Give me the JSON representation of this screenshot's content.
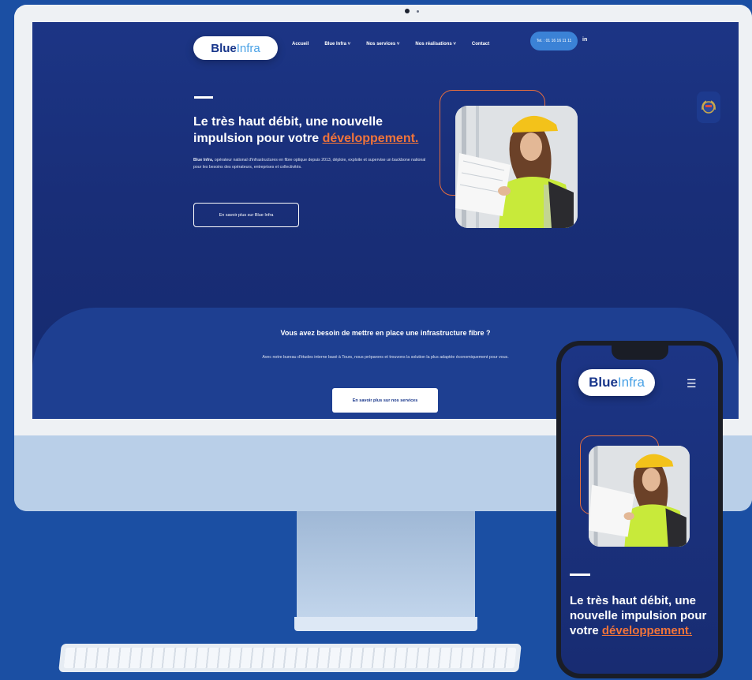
{
  "brand": {
    "name_bold": "Blue",
    "name_light": "Infra"
  },
  "nav": {
    "items": [
      "Accueil",
      "Blue Infra ˅",
      "Nos services ˅",
      "Nos réalisations ˅",
      "Contact"
    ],
    "tel": "Tel. : 01 16 16 11 11",
    "linkedin": "in"
  },
  "hero": {
    "title_plain": "Le très haut débit, une nouvelle impulsion pour votre ",
    "title_accent": "développement.",
    "desc_bold": "Blue Infra,",
    "desc_rest": " opérateur national d'infrastructures en fibre optique depuis 2013, déploie, exploite et supervise un backbone national pour les besoins des opérateurs, entreprises et collectivités.",
    "button": "En savoir plus sur Blue Infra"
  },
  "section2": {
    "title": "Vous avez besoin de mettre en place une infrastructure fibre ?",
    "desc": "Avec notre bureau d'études interne basé à Tours, nous préparons et trouvons la solution la plus adaptée économiquement pour vous.",
    "button": "En savoir plus sur nos services"
  },
  "mobile": {
    "title_plain": "Le très haut débit, une nouvelle impulsion pour votre ",
    "title_accent": "développement.",
    "menu_icon": "hamburger-icon"
  },
  "colors": {
    "brand_blue": "#1c3585",
    "accent": "#f2743a",
    "background": "#1b4fa3"
  }
}
